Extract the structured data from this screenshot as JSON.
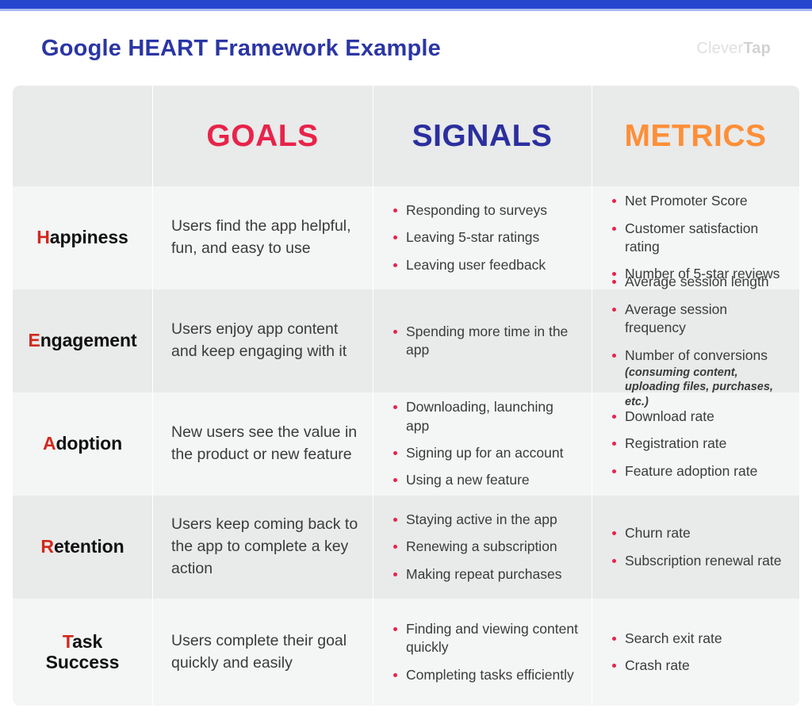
{
  "header": {
    "title": "Google HEART Framework Example",
    "logo_light": "Clever",
    "logo_bold": "Tap"
  },
  "colors": {
    "top_bar": "#2746ce",
    "title": "#2b36a4",
    "goals": "#e8234a",
    "signals": "#2b2f9e",
    "metrics": "#fd8f38",
    "initial_letter": "#d2291c",
    "bullet": "#e8234a",
    "row_dark": "#e9eaea",
    "row_light": "#f4f5f5"
  },
  "table": {
    "columns": [
      {
        "label": ""
      },
      {
        "label": "GOALS"
      },
      {
        "label": "SIGNALS"
      },
      {
        "label": "METRICS"
      }
    ],
    "rows": [
      {
        "initial": "H",
        "rest": "appiness",
        "goal": "Users find the app helpful, fun, and easy to use",
        "signals": [
          "Responding to surveys",
          "Leaving 5-star ratings",
          "Leaving user feedback"
        ],
        "metrics": [
          "Net Promoter Score",
          "Customer satisfaction rating",
          "Number of 5-star reviews"
        ]
      },
      {
        "initial": "E",
        "rest": "ngagement",
        "goal": "Users enjoy app content and keep engaging with it",
        "signals": [
          "Spending more time in the app"
        ],
        "metrics": [
          "Average session length",
          "Average session frequency",
          "Number of conversions"
        ],
        "metrics_note": "(consuming content, uploading files, purchases, etc.)"
      },
      {
        "initial": "A",
        "rest": "doption",
        "goal": "New users see the value in the product or new feature",
        "signals": [
          "Downloading, launching app",
          "Signing up for an account",
          "Using a new feature"
        ],
        "metrics": [
          "Download rate",
          "Registration rate",
          "Feature adoption rate"
        ]
      },
      {
        "initial": "R",
        "rest": "etention",
        "goal": "Users keep coming back to the app to complete a key action",
        "signals": [
          "Staying active in the app",
          "Renewing a subscription",
          "Making repeat purchases"
        ],
        "metrics": [
          "Churn rate",
          "Subscription renewal rate"
        ]
      },
      {
        "initial": "T",
        "rest": "ask",
        "rest2": "Success",
        "goal": "Users complete their goal quickly and easily",
        "signals": [
          "Finding and viewing content quickly",
          "Completing tasks efficiently"
        ],
        "metrics": [
          "Search exit rate",
          "Crash rate"
        ]
      }
    ]
  }
}
